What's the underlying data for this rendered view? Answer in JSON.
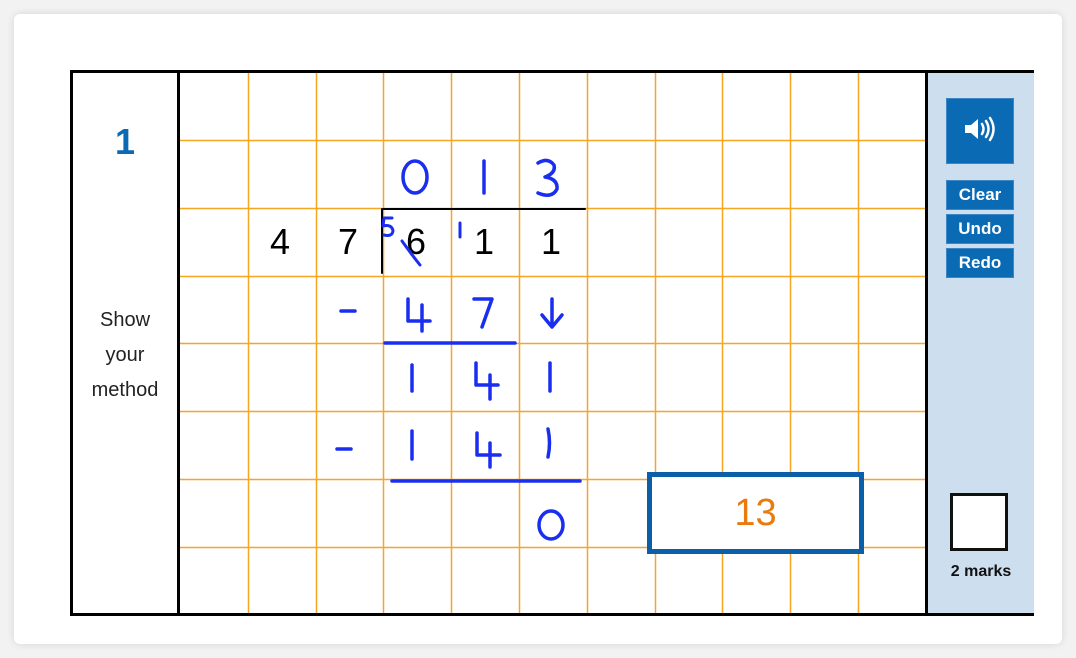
{
  "question": {
    "number": "1",
    "instruction_lines": [
      "Show",
      "your",
      "method"
    ]
  },
  "toolbar": {
    "audio_icon": "speaker-icon",
    "clear_label": "Clear",
    "undo_label": "Undo",
    "redo_label": "Redo"
  },
  "marks": {
    "label": "2 marks"
  },
  "answer": {
    "value": "13"
  },
  "working": {
    "divisor": [
      "4",
      "7"
    ],
    "dividend": [
      "6",
      "1",
      "1"
    ],
    "handwritten": {
      "quotient": [
        "0",
        "1",
        "3"
      ],
      "carry_marks": [
        "5",
        "1"
      ],
      "step1_subtract": [
        "-",
        "4",
        "7",
        "↓"
      ],
      "step1_remainder": [
        "1",
        "4",
        "1"
      ],
      "step2_subtract": [
        "-",
        "1",
        "4",
        "1"
      ],
      "final_remainder": [
        "0"
      ]
    }
  },
  "colors": {
    "accent_blue": "#0a6ab3",
    "grid_orange": "#f5a623",
    "ink_blue": "#1a2ef0",
    "answer_orange": "#e97b0d",
    "side_panel": "#cddeee"
  }
}
